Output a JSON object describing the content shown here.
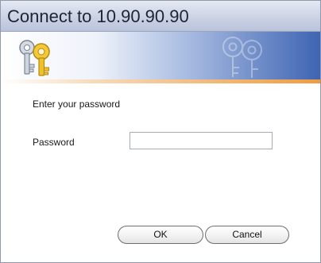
{
  "dialog": {
    "title": "Connect to 10.90.90.90",
    "banner_icon": "keys-icon",
    "prompt": "Enter your password",
    "password_label": "Password",
    "password_value": "",
    "ok_label": "OK",
    "cancel_label": "Cancel"
  },
  "colors": {
    "banner_blue": "#3e64b3",
    "banner_orange": "#ef9c40",
    "title_bar": "#cfd6e7"
  }
}
